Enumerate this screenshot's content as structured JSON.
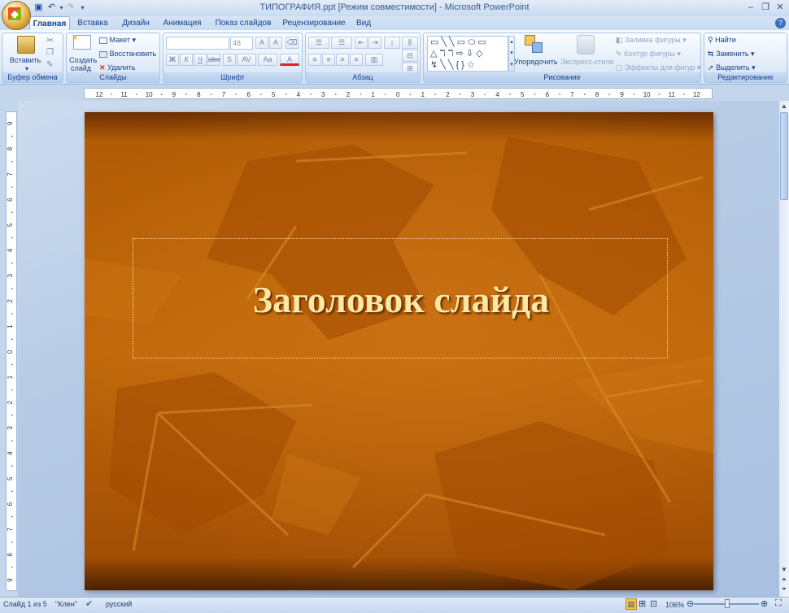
{
  "window": {
    "title": "ТИПОГРАФИЯ.ppt [Режим совместимости] - Microsoft PowerPoint"
  },
  "tabs": [
    "Главная",
    "Вставка",
    "Дизайн",
    "Анимация",
    "Показ слайдов",
    "Рецензирование",
    "Вид"
  ],
  "ribbon": {
    "clipboard": {
      "paste": "Вставить",
      "label": "Буфер обмена"
    },
    "slides": {
      "create": "Создать",
      "create2": "слайд",
      "layout": "Макет",
      "reset": "Восстановить",
      "delete": "Удалить",
      "label": "Слайды"
    },
    "font": {
      "size": "48",
      "label": "Шрифт",
      "bold": "Ж",
      "italic": "К",
      "underline": "Ч",
      "strike": "abc",
      "shadow": "S",
      "spacing": "AV",
      "case": "Aa",
      "color": "A"
    },
    "paragraph": {
      "label": "Абзац"
    },
    "drawing": {
      "arrange": "Упорядочить",
      "styles": "Экспресс-стили",
      "fill": "Заливка фигуры",
      "outline": "Контур фигуры",
      "effects": "Эффекты для фигур",
      "label": "Рисование"
    },
    "editing": {
      "find": "Найти",
      "replace": "Заменить",
      "select": "Выделить",
      "label": "Редактирование"
    }
  },
  "ruler": {
    "h": [
      "12",
      "11",
      "10",
      "9",
      "8",
      "7",
      "6",
      "5",
      "4",
      "3",
      "2",
      "1",
      "0",
      "1",
      "2",
      "3",
      "4",
      "5",
      "6",
      "7",
      "8",
      "9",
      "10",
      "11",
      "12"
    ],
    "v": [
      "9",
      "8",
      "7",
      "6",
      "5",
      "4",
      "3",
      "2",
      "1",
      "0",
      "1",
      "2",
      "3",
      "4",
      "5",
      "6",
      "7",
      "8",
      "9"
    ]
  },
  "slide": {
    "title": "Заголовок слайда"
  },
  "status": {
    "slide": "Слайд 1 из 5",
    "theme": "\"Клен\"",
    "lang": "русский",
    "zoom": "106%"
  },
  "colors": {
    "accent": "#15428b",
    "slide_bg": "#b05a06",
    "title": "#ffe7a3"
  }
}
